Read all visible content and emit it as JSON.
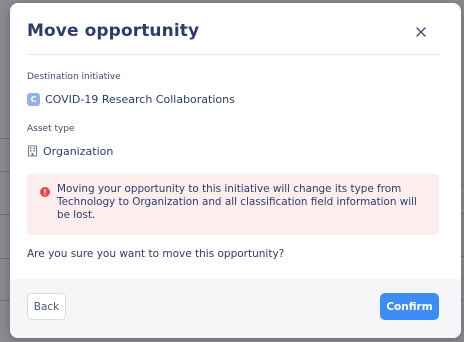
{
  "modal": {
    "title": "Move opportunity",
    "close_icon": "close-icon"
  },
  "destination": {
    "label": "Destination initiative",
    "badge_letter": "C",
    "badge_color": "#8fb2ea",
    "name": "COVID-19 Research Collaborations"
  },
  "asset": {
    "label": "Asset type",
    "icon": "building-icon",
    "name": "Organization"
  },
  "warning": {
    "icon": "alert-circle-icon",
    "icon_color": "#e5484d",
    "background": "#fdeeee",
    "text": "Moving your opportunity to this initiative will change its type from Technology to Organization and all classification field information will be lost."
  },
  "confirm_question": "Are you sure you want to move this opportunity?",
  "footer": {
    "back_label": "Back",
    "confirm_label": "Confirm",
    "confirm_color": "#3d8cf5"
  }
}
